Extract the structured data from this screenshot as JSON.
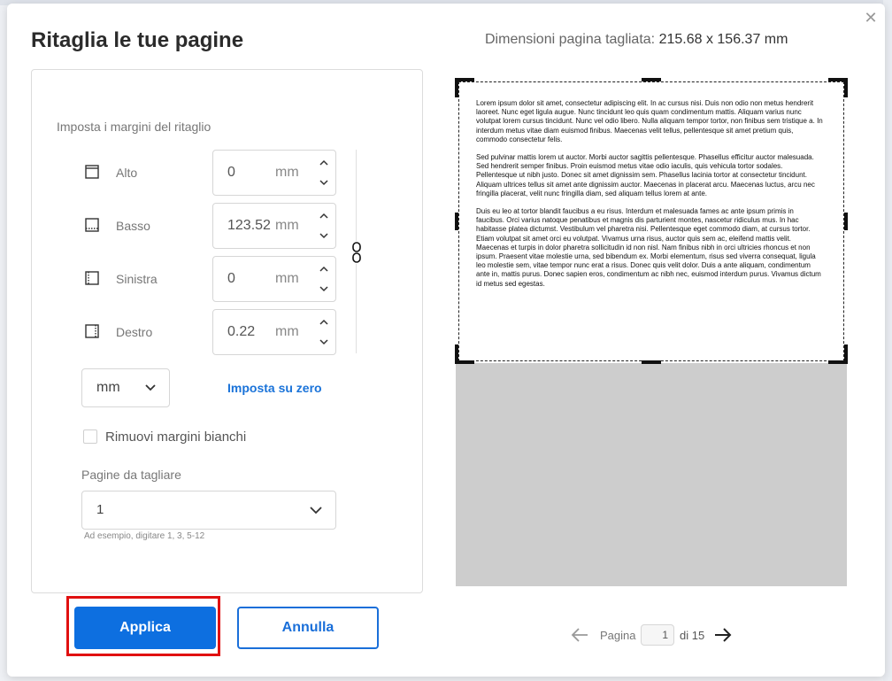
{
  "dialog": {
    "title": "Ritaglia le tue pagine",
    "dimensions_label": "Dimensioni pagina tagliata:",
    "dimensions_value": "215.68 x 156.37 mm",
    "close_icon": "close-icon"
  },
  "margins": {
    "section_label": "Imposta i margini del ritaglio",
    "unit": "mm",
    "rows": [
      {
        "label": "Alto",
        "value": "0"
      },
      {
        "label": "Basso",
        "value": "123.52"
      },
      {
        "label": "Sinistra",
        "value": "0"
      },
      {
        "label": "Destro",
        "value": "0.22"
      }
    ]
  },
  "unit_select": {
    "value": "mm"
  },
  "reset_link": "Imposta su zero",
  "remove_white": {
    "label": "Rimuovi margini bianchi",
    "checked": false
  },
  "pages": {
    "label": "Pagine da tagliare",
    "value": "1",
    "hint": "Ad esempio, digitare 1, 3, 5-12"
  },
  "actions": {
    "apply": "Applica",
    "cancel": "Annulla"
  },
  "preview": {
    "paragraphs": [
      "Lorem ipsum dolor sit amet, consectetur adipiscing elit. In ac cursus nisi. Duis non odio non metus hendrerit laoreet. Nunc eget ligula augue. Nunc tincidunt leo quis quam condimentum mattis. Aliquam varius nunc volutpat lorem cursus tincidunt. Nunc vel odio libero. Nulla aliquam tempor tortor, non finibus sem tristique a. In interdum metus vitae diam euismod finibus. Maecenas velit tellus, pellentesque sit amet pretium quis, commodo consectetur felis.",
      "Sed pulvinar mattis lorem ut auctor. Morbi auctor sagittis pellentesque. Phasellus efficitur auctor malesuada. Sed hendrerit semper finibus. Proin euismod metus vitae odio iaculis, quis vehicula tortor sodales. Pellentesque ut nibh justo. Donec sit amet dignissim sem. Phasellus lacinia tortor at consectetur tincidunt. Aliquam ultrices tellus sit amet ante dignissim auctor. Maecenas in placerat arcu. Maecenas luctus, arcu nec fringilla placerat, velit nunc fringilla diam, sed aliquam tellus lorem at ante.",
      "Duis eu leo at tortor blandit faucibus a eu risus. Interdum et malesuada fames ac ante ipsum primis in faucibus. Orci varius natoque penatibus et magnis dis parturient montes, nascetur ridiculus mus. In hac habitasse platea dictumst. Vestibulum vel pharetra nisi. Pellentesque eget commodo diam, at cursus tortor. Etiam volutpat sit amet orci eu volutpat. Vivamus urna risus, auctor quis sem ac, eleifend mattis velit. Maecenas et turpis in dolor pharetra sollicitudin id non nisl. Nam finibus nibh in orci ultricies rhoncus et non ipsum. Praesent vitae molestie urna, sed bibendum ex. Morbi elementum, risus sed viverra consequat, ligula leo molestie sem, vitae tempor nunc erat a risus. Donec quis velit dolor. Duis a ante aliquam, condimentum ante in, mattis purus. Donec sapien eros, condimentum ac nibh nec, euismod interdum purus. Vivamus dictum id metus sed egestas."
    ]
  },
  "pager": {
    "label": "Pagina",
    "current": "1",
    "total": "di 15"
  },
  "colors": {
    "primary": "#0d6fe0",
    "highlight": "#e01010",
    "preview_bg": "#cdcdcd"
  }
}
